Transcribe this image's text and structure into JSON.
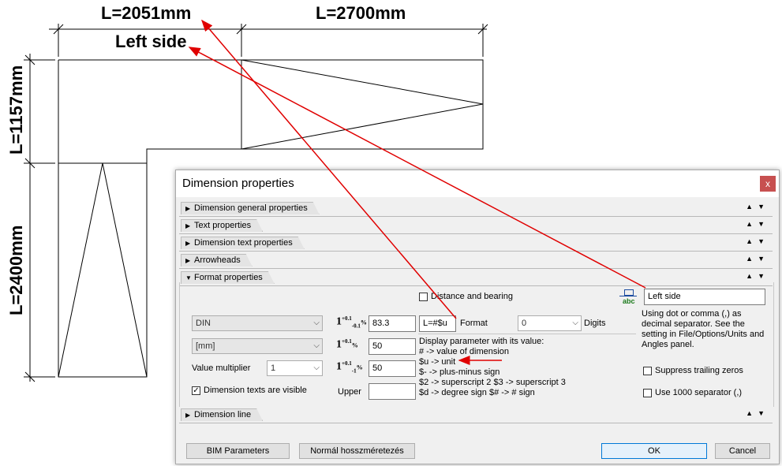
{
  "drawing": {
    "dim_top_left": "L=2051mm",
    "dim_top_right": "L=2700mm",
    "dim_left_top": "L=1157mm",
    "dim_left_bottom": "L=2400mm",
    "left_side_label": "Left side"
  },
  "dialog": {
    "title": "Dimension properties",
    "close_glyph": "x",
    "sections": {
      "general": "Dimension general properties",
      "text": "Text properties",
      "dimtext": "Dimension text properties",
      "arrowheads": "Arrowheads",
      "format": "Format properties",
      "dimline": "Dimension line"
    },
    "format": {
      "distance_bearing_label": "Distance and bearing",
      "text_value": "Left side",
      "standard_select": "DIN",
      "unit_select": "[mm]",
      "value_multiplier_label": "Value multiplier",
      "value_multiplier_select": "1",
      "texts_visible_label": "Dimension texts are visible",
      "upper_label": "Upper",
      "upper_value": "",
      "tol1_value": "83.3",
      "tol2_value": "50",
      "tol3_value": "50",
      "format_field_value": "L=#$u",
      "format_label": "Format",
      "digits_select": "0",
      "digits_label": "Digits",
      "help_title": "Display parameter with its value:",
      "help_lines": [
        "#  -> value of dimension",
        "$u -> unit",
        "$- -> plus-minus sign",
        "$2 -> superscript 2    $3 -> superscript 3",
        "$d -> degree sign    $# -> # sign"
      ],
      "separator_note": "Using dot or comma (,) as decimal separator. See the setting in File/Options/Units and Angles panel.",
      "suppress_zeros_label": "Suppress trailing zeros",
      "thousand_sep_label": "Use 1000 separator (,)"
    },
    "buttons": {
      "bim": "BIM Parameters",
      "normal": "Normál hosszméretezés",
      "ok": "OK",
      "cancel": "Cancel"
    }
  }
}
